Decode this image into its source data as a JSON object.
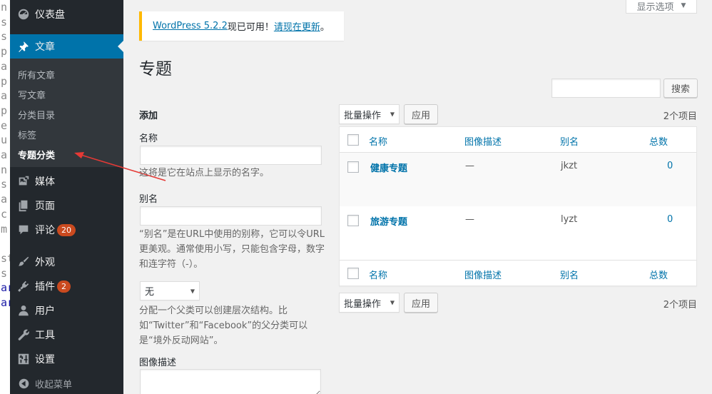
{
  "background_strip": {
    "chars": [
      "n",
      "s",
      "s",
      "p",
      "a",
      "p",
      "a",
      "p",
      "e",
      "u",
      "a",
      "n",
      "s",
      "a",
      "c",
      "m",
      "",
      "st",
      "s",
      "ar",
      "ar"
    ]
  },
  "sidebar": {
    "dashboard": "仪表盘",
    "posts": "文章",
    "posts_submenu": [
      "所有文章",
      "写文章",
      "分类目录",
      "标签",
      "专题分类"
    ],
    "media": "媒体",
    "pages": "页面",
    "comments": "评论",
    "comments_count": "20",
    "appearance": "外观",
    "plugins": "插件",
    "plugins_count": "2",
    "users": "用户",
    "tools": "工具",
    "settings": "设置",
    "collapse": "收起菜单"
  },
  "screen_options": {
    "label": "显示选项"
  },
  "notice": {
    "version_link": "WordPress 5.2.2",
    "text": "现已可用！",
    "update_link": "请现在更新",
    "end": "。"
  },
  "page": {
    "title": "专题"
  },
  "search": {
    "button": "搜索",
    "value": ""
  },
  "add_form": {
    "heading": "添加",
    "name_label": "名称",
    "name_help": "这将是它在站点上显示的名字。",
    "slug_label": "别名",
    "slug_help": "“别名”是在URL中使用的别称，它可以令URL更美观。通常使用小写，只能包含字母，数字和连字符（-）。",
    "parent_selected": "无",
    "parent_help": "分配一个父类可以创建层次结构。比如“Twitter”和“Facebook”的父分类可以是“境外反动网站”。",
    "description_label": "图像描述"
  },
  "table": {
    "bulk_actions": "批量操作",
    "apply": "应用",
    "items_count": "2个项目",
    "columns": [
      "名称",
      "图像描述",
      "别名",
      "总数"
    ],
    "rows": [
      {
        "name": "健康专题",
        "description": "—",
        "slug": "jkzt",
        "count": "0"
      },
      {
        "name": "旅游专题",
        "description": "—",
        "slug": "lyzt",
        "count": "0"
      }
    ]
  },
  "colors": {
    "sidebar_bg": "#23282d",
    "submenu_bg": "#32373c",
    "accent": "#0073aa",
    "badge": "#ca4a1f",
    "notice_border": "#ffb900",
    "annotation": "#e53935"
  }
}
